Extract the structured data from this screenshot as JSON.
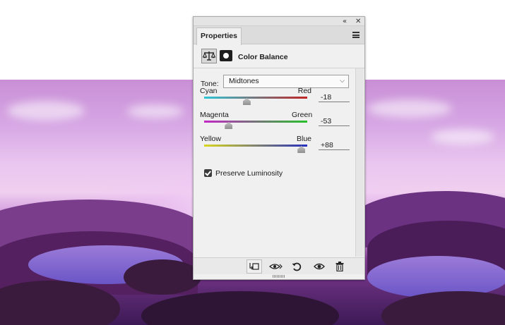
{
  "panel": {
    "titlebar": {
      "collapse_icon": "«",
      "close_icon": "✕"
    },
    "tab": {
      "label": "Properties"
    },
    "menu_icon": "hamburger-menu-icon",
    "adjustment": {
      "title": "Color Balance",
      "icon": "balance-scale-icon",
      "mask_icon": "layer-mask-icon"
    },
    "tone": {
      "label": "Tone:",
      "selected": "Midtones"
    },
    "sliders": [
      {
        "left_label": "Cyan",
        "right_label": "Red",
        "value_text": "-18",
        "value": -18,
        "min": -100,
        "max": 100,
        "gradient": [
          "#2ec6d6",
          "#c02424"
        ]
      },
      {
        "left_label": "Magenta",
        "right_label": "Green",
        "value_text": "-53",
        "value": -53,
        "min": -100,
        "max": 100,
        "gradient": [
          "#c226c6",
          "#27c02a"
        ]
      },
      {
        "left_label": "Yellow",
        "right_label": "Blue",
        "value_text": "+88",
        "value": 88,
        "min": -100,
        "max": 100,
        "gradient": [
          "#d9d61c",
          "#262fbf"
        ]
      }
    ],
    "preserve_luminosity": {
      "label": "Preserve Luminosity",
      "checked": true
    },
    "bottom_toolbar": [
      {
        "name": "clip-to-layer-icon"
      },
      {
        "name": "view-previous-state-icon"
      },
      {
        "name": "reset-icon"
      },
      {
        "name": "visibility-eye-icon"
      },
      {
        "name": "trash-icon"
      }
    ]
  }
}
